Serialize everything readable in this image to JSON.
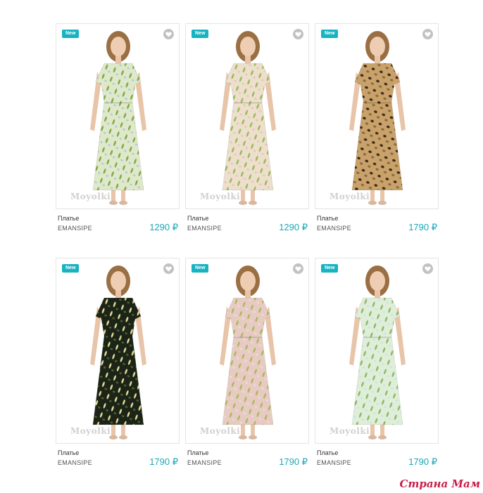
{
  "products": [
    {
      "badge": "New",
      "name": "Платье",
      "brand": "EMANSIPE",
      "price": "1290 ₽",
      "watermark": "Moyolki",
      "pattern": "floral-sage",
      "colors": [
        "#dfe8c8",
        "#7ea648",
        "#a8cfe0"
      ]
    },
    {
      "badge": "New",
      "name": "Платье",
      "brand": "EMANSIPE",
      "price": "1290 ₽",
      "watermark": "Moyolki",
      "pattern": "floral-beige",
      "colors": [
        "#ecdfcb",
        "#9ab65a",
        "#e7c7b8"
      ]
    },
    {
      "badge": "New",
      "name": "Платье",
      "brand": "EMANSIPE",
      "price": "1790 ₽",
      "watermark": "Moyolki",
      "pattern": "leopard",
      "colors": [
        "#c8a26a",
        "#3c2a18",
        "#8e6b3c"
      ]
    },
    {
      "badge": "New",
      "name": "Платье",
      "brand": "EMANSIPE",
      "price": "1790 ₽",
      "watermark": "Moyolki",
      "pattern": "floral-dark",
      "colors": [
        "#1c2417",
        "#e6df9e",
        "#4c6330"
      ]
    },
    {
      "badge": "New",
      "name": "Платье",
      "brand": "EMANSIPE",
      "price": "1790 ₽",
      "watermark": "Moyolki",
      "pattern": "floral-pink",
      "colors": [
        "#e7cbc3",
        "#a8b85a",
        "#f0d9d2"
      ]
    },
    {
      "badge": "New",
      "name": "Платье",
      "brand": "EMANSIPE",
      "price": "1790 ₽",
      "watermark": "Moyolki",
      "pattern": "floral-mint",
      "colors": [
        "#dfeed9",
        "#8db662",
        "#c9e6dc"
      ]
    }
  ],
  "site_watermark": "Страна Мам"
}
